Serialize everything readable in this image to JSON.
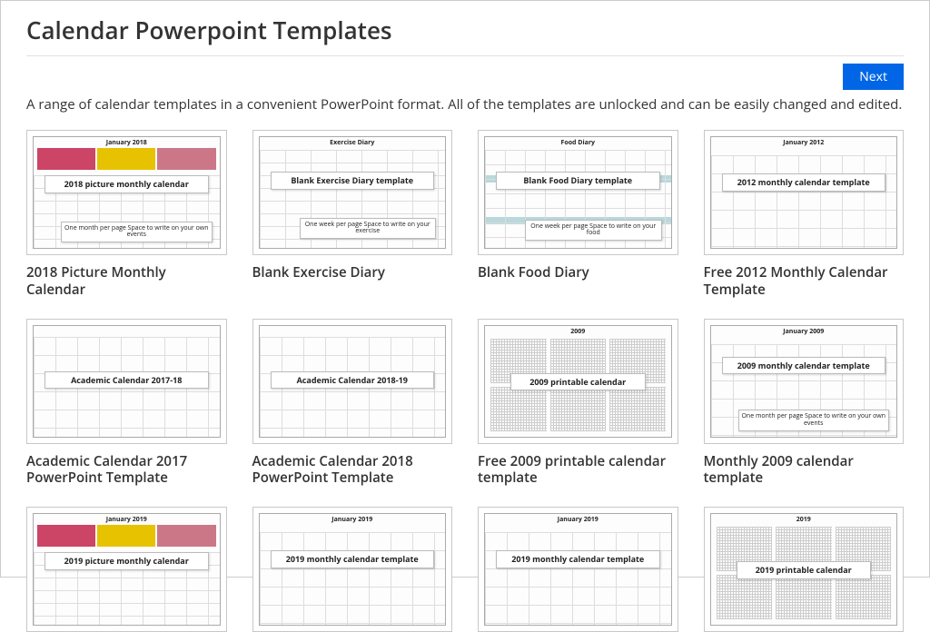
{
  "header": {
    "title": "Calendar Powerpoint Templates"
  },
  "nav": {
    "next_label": "Next"
  },
  "intro": "A range of calendar templates in a convenient PowerPoint format. All of the templates are unlocked and can be easily changed and edited.",
  "cards": [
    {
      "title": "2018 Picture Monthly Calendar",
      "thumb_heading": "January 2018",
      "badge_main": "2018 picture monthly calendar",
      "badge_sub": "One month per page\nSpace to write on your own events",
      "variant": "picture"
    },
    {
      "title": "Blank Exercise Diary",
      "thumb_heading": "Exercise Diary",
      "badge_main": "Blank Exercise Diary template",
      "badge_sub": "One week per page\nSpace to write on your exercise",
      "variant": "diary"
    },
    {
      "title": "Blank Food Diary",
      "thumb_heading": "Food Diary",
      "badge_main": "Blank Food Diary template",
      "badge_sub": "One week per page\nSpace to write on your food",
      "variant": "food"
    },
    {
      "title": "Free 2012 Monthly Calendar Template",
      "thumb_heading": "January 2012",
      "badge_main": "2012 monthly calendar template",
      "badge_sub": "",
      "variant": "month"
    },
    {
      "title": "Academic Calendar 2017 PowerPoint Template",
      "thumb_heading": "",
      "badge_main": "Academic Calendar 2017-18",
      "badge_sub": "",
      "variant": "academic"
    },
    {
      "title": "Academic Calendar 2018 PowerPoint Template",
      "thumb_heading": "",
      "badge_main": "Academic Calendar 2018-19",
      "badge_sub": "",
      "variant": "academic"
    },
    {
      "title": "Free 2009 printable calendar template",
      "thumb_heading": "2009",
      "badge_main": "2009 printable calendar",
      "badge_sub": "",
      "variant": "year"
    },
    {
      "title": "Monthly 2009 calendar template",
      "thumb_heading": "January 2009",
      "badge_main": "2009 monthly calendar template",
      "badge_sub": "One month per page\nSpace to write on your own events",
      "variant": "month"
    },
    {
      "title": "",
      "thumb_heading": "January 2019",
      "badge_main": "2019 picture monthly calendar",
      "badge_sub": "",
      "variant": "picture"
    },
    {
      "title": "",
      "thumb_heading": "January 2019",
      "badge_main": "2019 monthly calendar template",
      "badge_sub": "",
      "variant": "month"
    },
    {
      "title": "",
      "thumb_heading": "January 2019",
      "badge_main": "2019 monthly calendar template",
      "badge_sub": "",
      "variant": "month"
    },
    {
      "title": "",
      "thumb_heading": "2019",
      "badge_main": "2019 printable calendar",
      "badge_sub": "",
      "variant": "year"
    }
  ]
}
